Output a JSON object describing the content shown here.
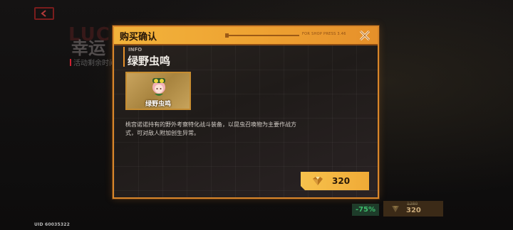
{
  "background": {
    "back_icon": "chevron-left-icon",
    "lucky_text": "LUCK",
    "title": "幸运",
    "timer_text": "活动剩余时间",
    "uid": "UID 60035322",
    "discount": "-75%",
    "old_price": "1280",
    "new_price": "320"
  },
  "dialog": {
    "title": "购买确认",
    "tag": "FOR SHOP PRESS 3.46",
    "close_icon": "close-icon",
    "info_label": "INFO",
    "item_name": "绿野虫鸣",
    "card_label": "绿野虫鸣",
    "description": "桃宫诺诺持有的野外考察特化战斗装备，以昆虫召唤物为主要作战方式，可对敌人附加创生异常。",
    "price": "320",
    "currency_icon": "diamond-icon"
  },
  "colors": {
    "accent": "#f0aa36",
    "header": "#f2b33b",
    "border": "#d8862b",
    "discount_green": "#3dbb6a"
  }
}
